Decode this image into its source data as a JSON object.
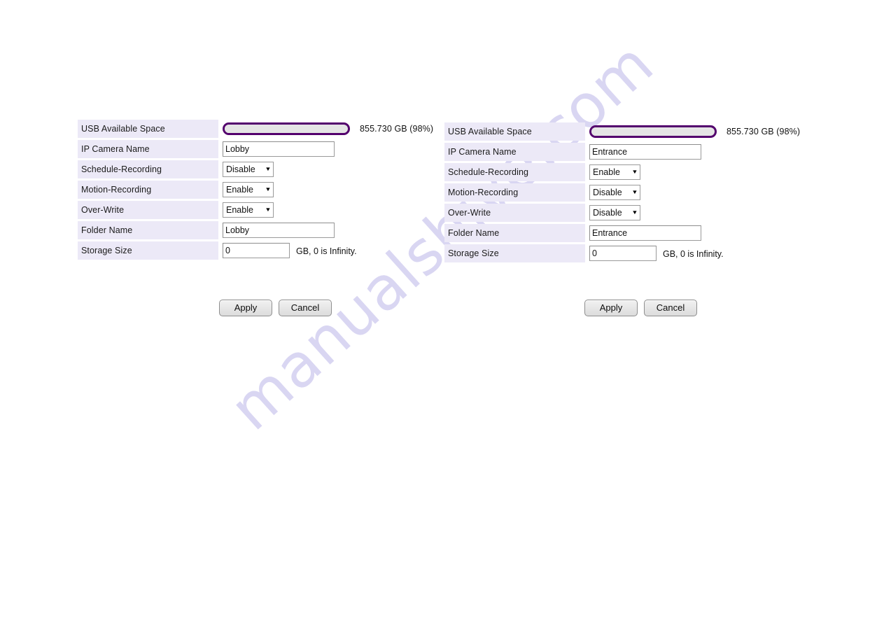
{
  "watermark": {
    "text": "manualshive.com"
  },
  "panels": [
    {
      "id": "left",
      "rows": {
        "usb_label": "USB Available Space",
        "usb_value": "855.730 GB (98%)",
        "usb_percent": 98,
        "camera_name_label": "IP Camera Name",
        "camera_name_value": "Lobby",
        "schedule_recording_label": "Schedule-Recording",
        "schedule_recording_value": "Disable",
        "motion_recording_label": "Motion-Recording",
        "motion_recording_value": "Enable",
        "over_write_label": "Over-Write",
        "over_write_value": "Enable",
        "folder_name_label": "Folder Name",
        "folder_name_value": "Lobby",
        "storage_size_label": "Storage Size",
        "storage_size_value": "0",
        "storage_size_suffix": "GB, 0 is Infinity."
      },
      "buttons": {
        "apply": "Apply",
        "cancel": "Cancel"
      }
    },
    {
      "id": "right",
      "rows": {
        "usb_label": "USB Available Space",
        "usb_value": "855.730 GB (98%)",
        "usb_percent": 98,
        "camera_name_label": "IP Camera Name",
        "camera_name_value": "Entrance",
        "schedule_recording_label": "Schedule-Recording",
        "schedule_recording_value": "Enable",
        "motion_recording_label": "Motion-Recording",
        "motion_recording_value": "Disable",
        "over_write_label": "Over-Write",
        "over_write_value": "Disable",
        "folder_name_label": "Folder Name",
        "folder_name_value": "Entrance",
        "storage_size_label": "Storage Size",
        "storage_size_value": "0",
        "storage_size_suffix": "GB, 0 is Infinity."
      },
      "buttons": {
        "apply": "Apply",
        "cancel": "Cancel"
      }
    }
  ],
  "icons": {
    "dropdown_arrow": "▼"
  },
  "colors": {
    "label_background": "#ece9f7",
    "progress_border": "#53006d",
    "progress_fill": "#e5e5e5",
    "watermark": "#d9d6f2",
    "text": "#111111"
  },
  "select_options": [
    "Enable",
    "Disable"
  ]
}
